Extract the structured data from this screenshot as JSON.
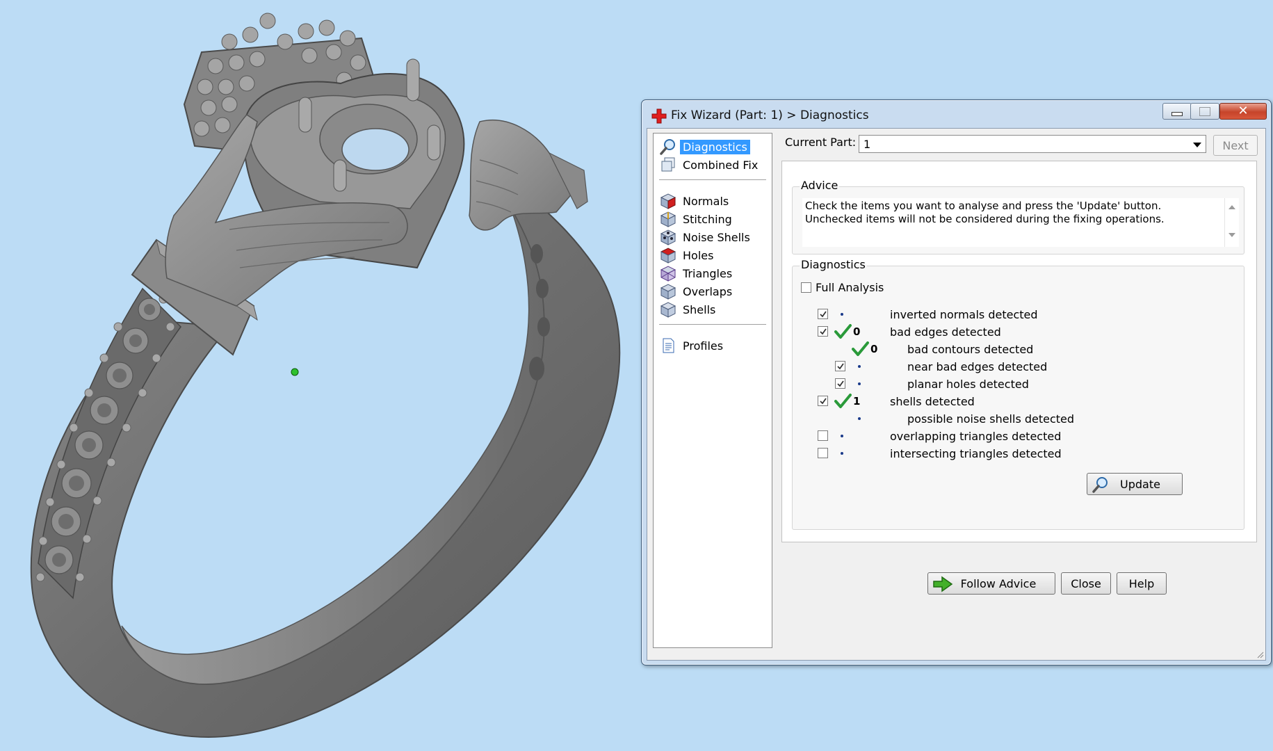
{
  "window": {
    "title": "Fix Wizard (Part: 1) > Diagnostics",
    "controls": [
      "minimize",
      "maximize",
      "close"
    ]
  },
  "nav": {
    "items": [
      {
        "label": "Diagnostics",
        "icon": "magnifier-icon",
        "selected": true
      },
      {
        "label": "Combined Fix",
        "icon": "combined-fix-icon"
      },
      {
        "label": "Normals",
        "icon": "normals-cube-icon"
      },
      {
        "label": "Stitching",
        "icon": "stitching-cube-icon"
      },
      {
        "label": "Noise Shells",
        "icon": "noise-shells-cube-icon"
      },
      {
        "label": "Holes",
        "icon": "holes-cube-icon"
      },
      {
        "label": "Triangles",
        "icon": "triangles-cube-icon"
      },
      {
        "label": "Overlaps",
        "icon": "overlaps-cube-icon"
      },
      {
        "label": "Shells",
        "icon": "shells-cube-icon"
      },
      {
        "label": "Profiles",
        "icon": "profile-document-icon"
      }
    ]
  },
  "current_part": {
    "label": "Current Part:",
    "value": "1",
    "next_label": "Next",
    "next_enabled": false
  },
  "advice": {
    "title": "Advice",
    "text": "Check the items you want to analyse and press the 'Update' button. Unchecked items will not be considered during the fixing operations."
  },
  "diagnostics": {
    "title": "Diagnostics",
    "full_analysis": {
      "label": "Full Analysis",
      "checked": false
    },
    "rows": [
      {
        "label": "inverted normals detected",
        "checked": true,
        "status": "dot",
        "count": ""
      },
      {
        "label": "bad edges detected",
        "checked": true,
        "status": "check",
        "count": "0"
      },
      {
        "label": "bad contours detected",
        "checked": null,
        "status": "check",
        "count": "0"
      },
      {
        "label": "near bad edges detected",
        "checked": true,
        "status": "dot",
        "count": ""
      },
      {
        "label": "planar holes detected",
        "checked": true,
        "status": "dot",
        "count": ""
      },
      {
        "label": "shells detected",
        "checked": true,
        "status": "check",
        "count": "1"
      },
      {
        "label": "possible noise shells detected",
        "checked": null,
        "status": "dot",
        "count": ""
      },
      {
        "label": "overlapping triangles detected",
        "checked": false,
        "status": "dot",
        "count": ""
      },
      {
        "label": "intersecting triangles detected",
        "checked": false,
        "status": "dot",
        "count": ""
      }
    ],
    "update_label": "Update"
  },
  "footer": {
    "follow_advice_label": "Follow Advice",
    "close_label": "Close",
    "help_label": "Help"
  },
  "colors": {
    "desktop_background": "#bcdcf5",
    "selection": "#3399ff",
    "ok_check": "#2a9a3a",
    "model_gray": "#7d7d7d"
  }
}
